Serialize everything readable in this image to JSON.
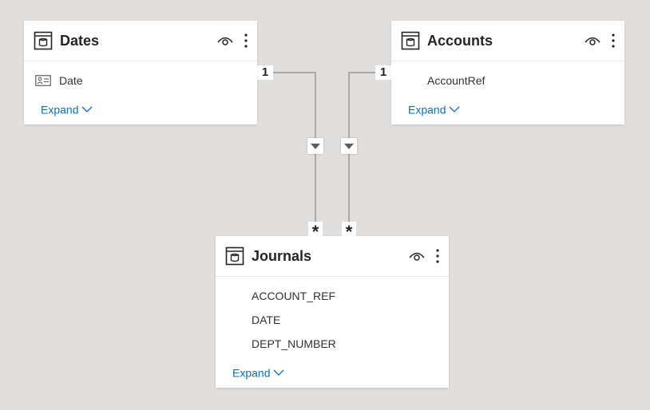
{
  "tables": {
    "dates": {
      "title": "Dates",
      "fields": [
        "Date"
      ],
      "expand_label": "Expand"
    },
    "accounts": {
      "title": "Accounts",
      "fields": [
        "AccountRef"
      ],
      "expand_label": "Expand"
    },
    "journals": {
      "title": "Journals",
      "fields": [
        "ACCOUNT_REF",
        "DATE",
        "DEPT_NUMBER"
      ],
      "expand_label": "Expand"
    }
  },
  "relationships": [
    {
      "from": "Dates",
      "to": "Journals",
      "from_cardinality": "1",
      "to_cardinality": "*",
      "filter_direction": "single"
    },
    {
      "from": "Accounts",
      "to": "Journals",
      "from_cardinality": "1",
      "to_cardinality": "*",
      "filter_direction": "single"
    }
  ],
  "colors": {
    "canvas_bg": "#e1dfdd",
    "card_bg": "#ffffff",
    "link_color": "#106ebe",
    "line_color": "#8a8886",
    "text_color": "#252423"
  },
  "icons": {
    "table": "table-icon",
    "visibility": "eye-icon",
    "more": "more-options-icon",
    "field": "field-card-icon",
    "filter": "filter-direction-icon",
    "expand": "chevron-down-icon"
  }
}
